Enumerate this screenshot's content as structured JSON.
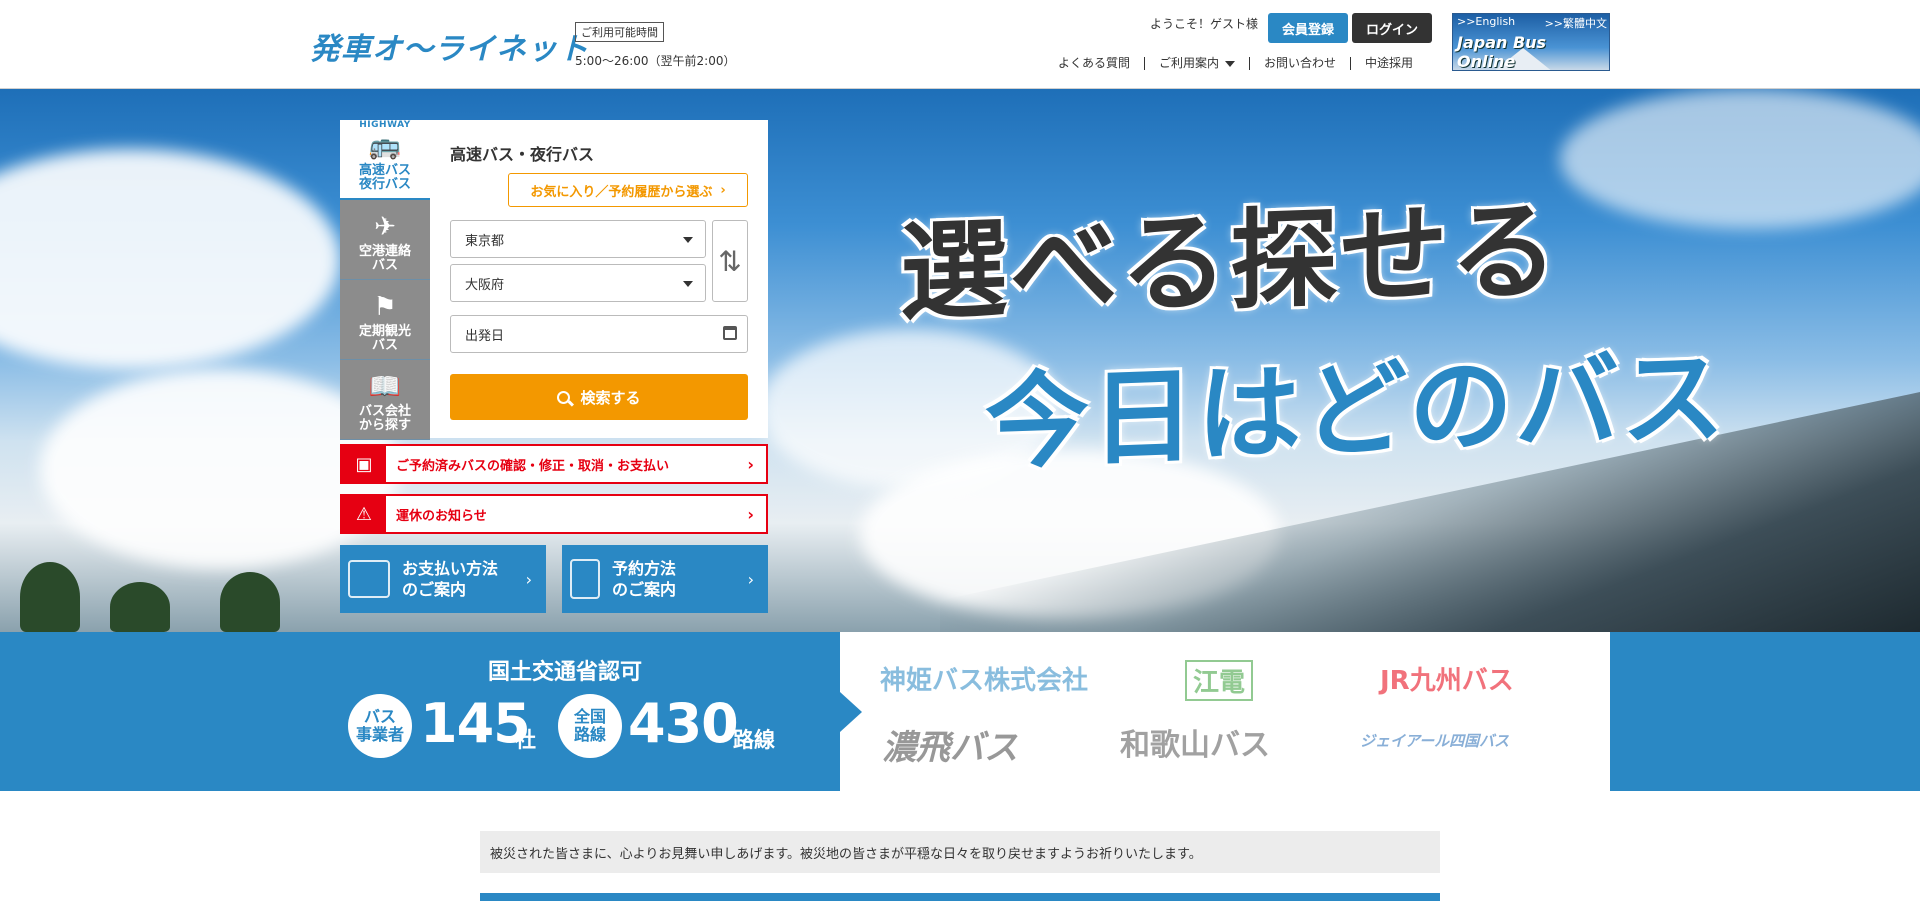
{
  "header": {
    "logo": "発車オ〜ライネット",
    "hours_label": "ご利用可能時間",
    "hours_value": "5:00〜26:00（翌午前2:00）",
    "welcome": "ようこそ！ゲスト様",
    "register_label": "会員登録",
    "login_label": "ログイン",
    "nav": [
      "よくある質問",
      "ご利用案内",
      "お問い合わせ",
      "中途採用"
    ],
    "banner": {
      "english_link": ">>English",
      "chinese_link": ">>繁體中文",
      "title": "Japan Bus Online"
    }
  },
  "hero": {
    "line1": "選べる探せる",
    "line2": "今日はどのバス"
  },
  "search": {
    "tabs": [
      {
        "tag": "HIGHWAY",
        "label1": "高速バス",
        "label2": "夜行バス",
        "icon": "bus-icon"
      },
      {
        "label1": "空港連絡",
        "label2": "バス",
        "icon": "airplane-bus-icon"
      },
      {
        "label1": "定期観光",
        "label2": "バス",
        "icon": "flag-icon"
      },
      {
        "label1": "バス会社",
        "label2": "から探す",
        "icon": "book-icon"
      }
    ],
    "title": "高速バス・夜行バス",
    "favorites_button": "お気に入り／予約履歴から選ぶ",
    "from_value": "東京都",
    "to_value": "大阪府",
    "date_placeholder": "出発日",
    "search_button": "検索する"
  },
  "links": {
    "reservation": "ご予約済みバスの確認・修正・取消・お支払い",
    "suspension": "運休のお知らせ",
    "payment_line1": "お支払い方法",
    "payment_line2": "のご案内",
    "booking_line1": "予約方法",
    "booking_line2": "のご案内"
  },
  "stats": {
    "title": "国土交通省認可",
    "operators_label1": "バス",
    "operators_label2": "事業者",
    "operators_count": "145",
    "operators_unit": "社",
    "routes_label1": "全国",
    "routes_label2": "路線",
    "routes_count": "430",
    "routes_unit": "路線"
  },
  "companies": [
    {
      "name": "神姫バス株式会社",
      "color": "#2a88c4"
    },
    {
      "name": "江電",
      "color": "#3aa03a"
    },
    {
      "name": "JR九州バス",
      "color": "#e60012"
    },
    {
      "name": "濃飛バス",
      "color": "#444444"
    },
    {
      "name": "和歌山バス",
      "color": "#555555"
    },
    {
      "name": "ジェイアール四国バス",
      "color": "#2a6fb8"
    }
  ],
  "notice": "被災された皆さまに、心よりお見舞い申しあげます。被災地の皆さまが平穏な日々を取り戻せますようお祈りいたします。",
  "colors": {
    "brand_blue": "#2a88c4",
    "accent_orange": "#f39800",
    "alert_red": "#e60012"
  }
}
